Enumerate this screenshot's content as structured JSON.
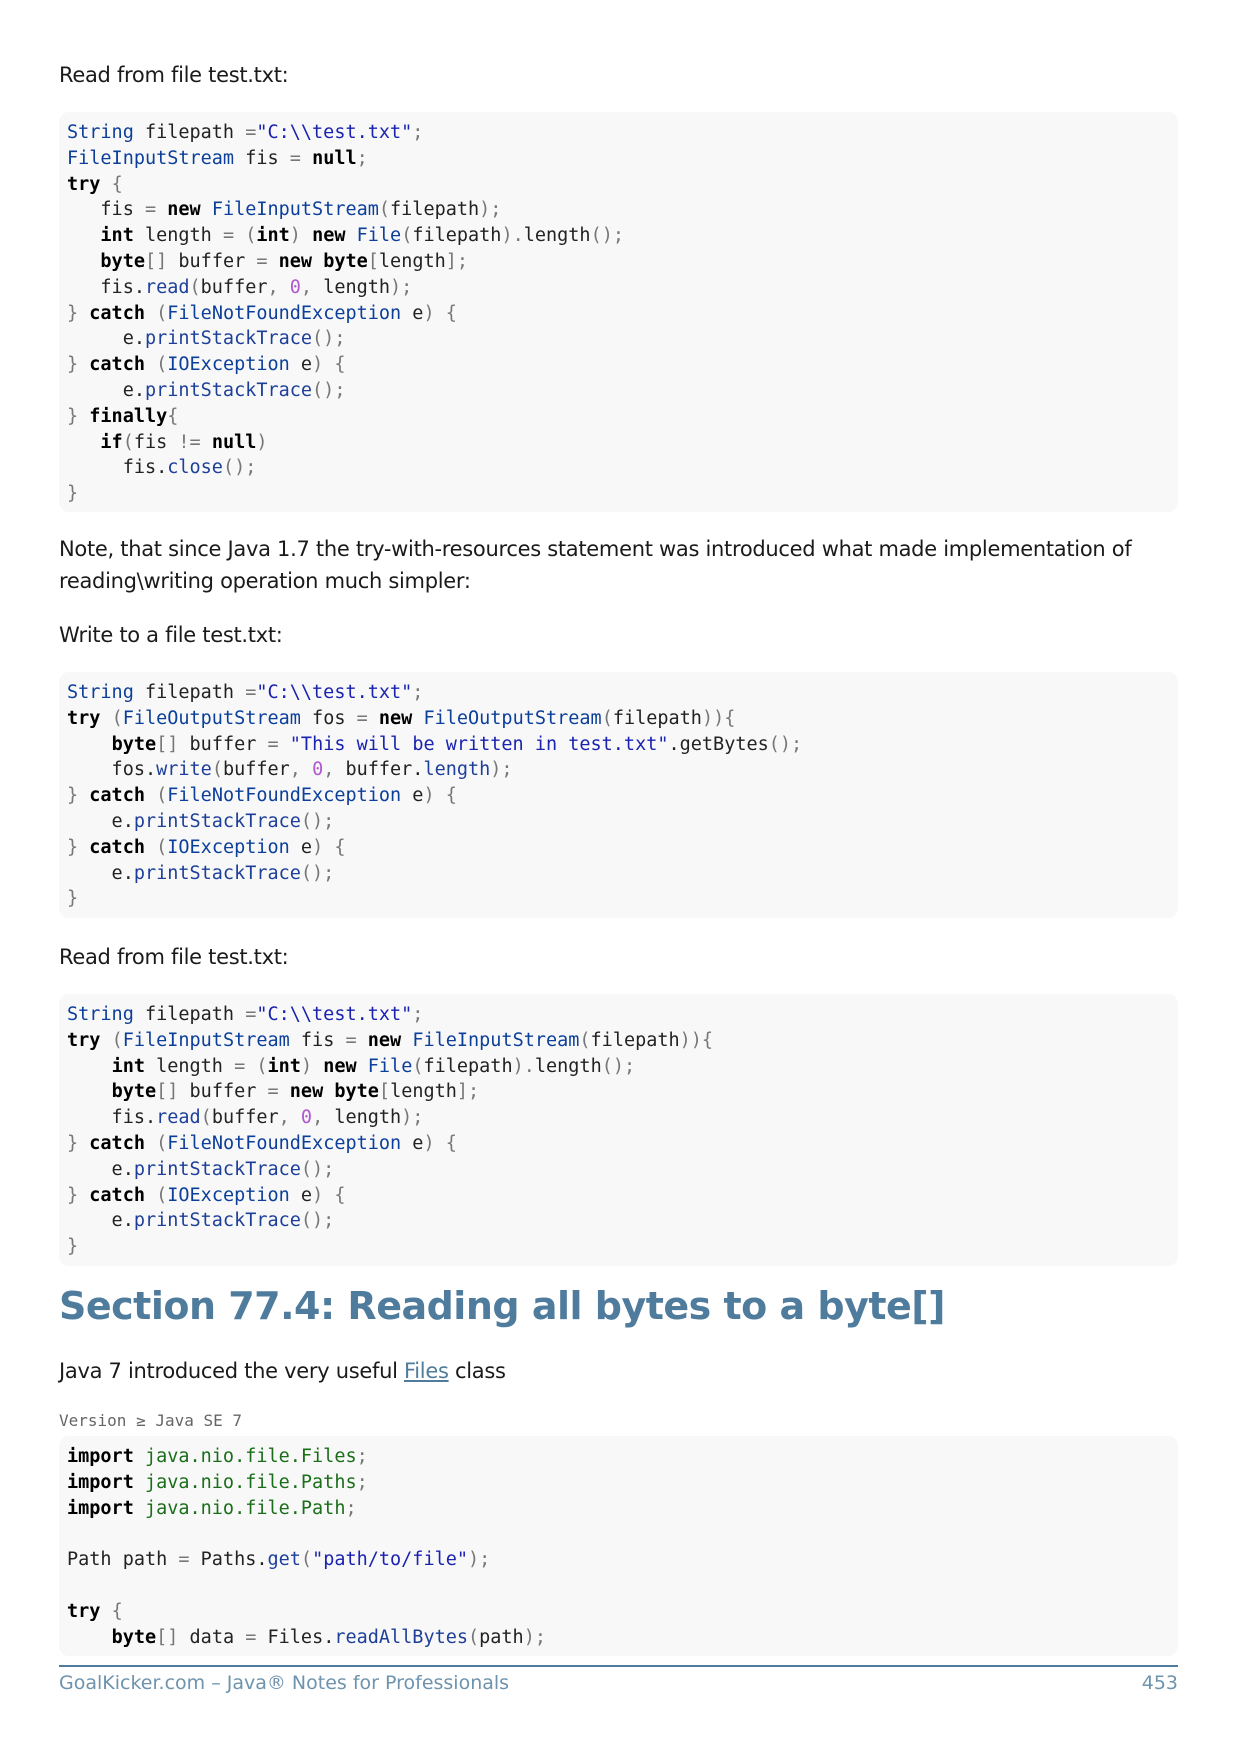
{
  "paragraphs": {
    "read_intro_1": "Read from file test.txt:",
    "note": "Note, that since Java 1.7 the try-with-resources statement was introduced what made implementation of reading\\writing operation much simpler:",
    "write_intro": "Write to a file test.txt:",
    "read_intro_2": "Read from file test.txt:",
    "files_intro_before": "Java 7 introduced the very useful ",
    "files_link": "Files",
    "files_intro_after": " class"
  },
  "section": {
    "heading": "Section 77.4: Reading all bytes to a byte[]"
  },
  "version_note": "Version ≥ Java SE 7",
  "code_blocks": {
    "block1": "String filepath =\"C:\\\\test.txt\";\nFileInputStream fis = null;\ntry {\n   fis = new FileInputStream(filepath);\n   int length = (int) new File(filepath).length();\n   byte[] buffer = new byte[length];\n   fis.read(buffer, 0, length);\n} catch (FileNotFoundException e) {\n     e.printStackTrace();\n} catch (IOException e) {\n     e.printStackTrace();\n} finally{\n   if(fis != null)\n     fis.close();\n}",
    "block2": "String filepath =\"C:\\\\test.txt\";\ntry (FileOutputStream fos = new FileOutputStream(filepath)){\n    byte[] buffer = \"This will be written in test.txt\".getBytes();\n    fos.write(buffer, 0, buffer.length);\n} catch (FileNotFoundException e) {\n    e.printStackTrace();\n} catch (IOException e) {\n    e.printStackTrace();\n}",
    "block3": "String filepath =\"C:\\\\test.txt\";\ntry (FileInputStream fis = new FileInputStream(filepath)){\n    int length = (int) new File(filepath).length();\n    byte[] buffer = new byte[length];\n    fis.read(buffer, 0, length);\n} catch (FileNotFoundException e) {\n    e.printStackTrace();\n} catch (IOException e) {\n    e.printStackTrace();\n}",
    "block4": "import java.nio.file.Files;\nimport java.nio.file.Paths;\nimport java.nio.file.Path;\n\nPath path = Paths.get(\"path/to/file\");\n\ntry {\n    byte[] data = Files.readAllBytes(path);"
  },
  "footer": {
    "left": "GoalKicker.com – Java® Notes for Professionals",
    "page_number": "453"
  }
}
